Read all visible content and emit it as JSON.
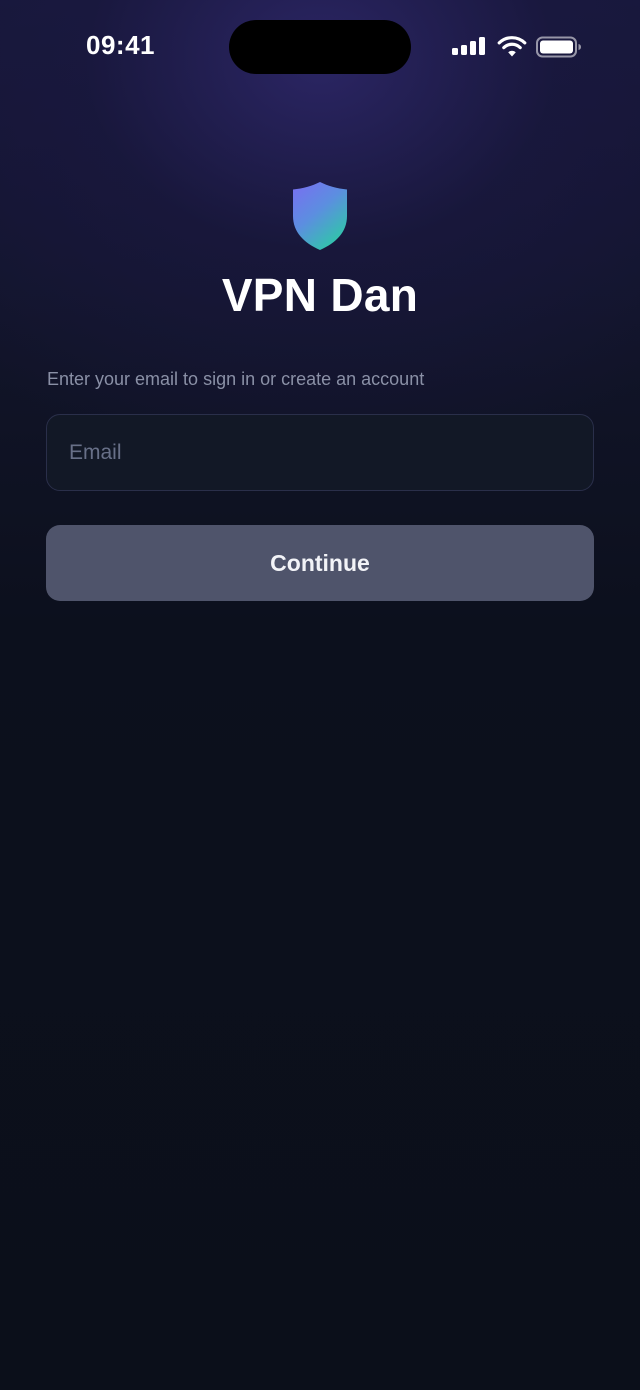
{
  "status_bar": {
    "time": "09:41",
    "signal_icon": "cellular-signal-icon",
    "wifi_icon": "wifi-icon",
    "battery_icon": "battery-icon"
  },
  "app": {
    "logo_icon": "shield-icon",
    "title": "VPN Dan"
  },
  "signin": {
    "subtitle": "Enter your email to sign in or create an account",
    "email_value": "",
    "email_placeholder": "Email",
    "continue_label": "Continue"
  },
  "colors": {
    "background": "#0b0f1a",
    "shield_gradient_top": "#7a6df2",
    "shield_gradient_bottom": "#2fc7a8",
    "button_background": "#4f546b",
    "input_border": "#2a2f4a"
  }
}
